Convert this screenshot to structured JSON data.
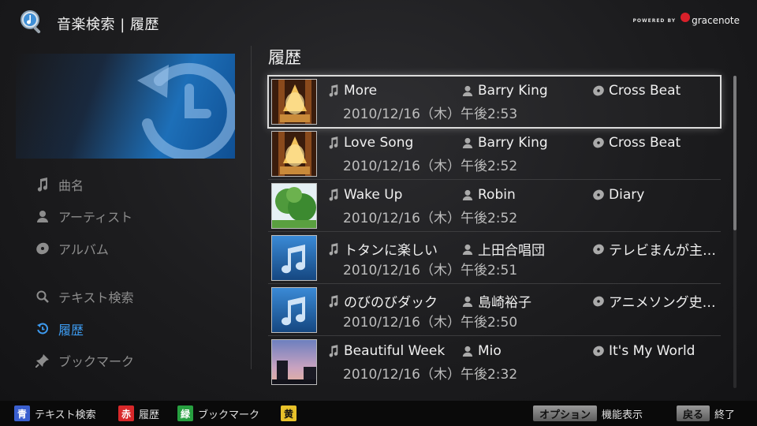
{
  "header": {
    "title": "音楽検索 | 履歴",
    "logo_powered": "POWERED BY",
    "logo_brand": "gracenote"
  },
  "sidebar": {
    "items": [
      {
        "label": "曲名",
        "icon": "music-note-icon",
        "active": false
      },
      {
        "label": "アーティスト",
        "icon": "person-icon",
        "active": false
      },
      {
        "label": "アルバム",
        "icon": "disc-icon",
        "active": false
      },
      {
        "label": "テキスト検索",
        "icon": "search-icon",
        "active": false
      },
      {
        "label": "履歴",
        "icon": "history-icon",
        "active": true
      },
      {
        "label": "ブックマーク",
        "icon": "bookmark-pin-icon",
        "active": false
      }
    ]
  },
  "main": {
    "section_title": "履歴",
    "rows": [
      {
        "song": "More",
        "artist": "Barry King",
        "album": "Cross Beat",
        "datetime": "2010/12/16（木）午後2:53",
        "thumb": "chandelier",
        "selected": true
      },
      {
        "song": "Love Song",
        "artist": "Barry King",
        "album": "Cross Beat",
        "datetime": "2010/12/16（木）午後2:52",
        "thumb": "chandelier",
        "selected": false
      },
      {
        "song": "Wake Up",
        "artist": "Robin",
        "album": "Diary",
        "datetime": "2010/12/16（木）午後2:52",
        "thumb": "tree",
        "selected": false
      },
      {
        "song": "トタンに楽しい",
        "artist": "上田合唱団",
        "album": "テレビまんが主…",
        "datetime": "2010/12/16（木）午後2:51",
        "thumb": "note",
        "selected": false
      },
      {
        "song": "のびのびダック",
        "artist": "島崎裕子",
        "album": "アニメソング史…",
        "datetime": "2010/12/16（木）午後2:50",
        "thumb": "note",
        "selected": false
      },
      {
        "song": "Beautiful Week",
        "artist": "Mio",
        "album": "It's My World",
        "datetime": "2010/12/16（木）午後2:32",
        "thumb": "dusk",
        "selected": false
      }
    ]
  },
  "footer": {
    "blue": {
      "key": "青",
      "label": "テキスト検索",
      "color": "#3a5fcf"
    },
    "red": {
      "key": "赤",
      "label": "履歴",
      "color": "#d8282a"
    },
    "green": {
      "key": "緑",
      "label": "ブックマーク",
      "color": "#27a040"
    },
    "yellow": {
      "key": "黄",
      "label": "",
      "color": "#e8c22a"
    },
    "option": {
      "key": "オプション",
      "label": "機能表示"
    },
    "back": {
      "key": "戻る",
      "label": "終了"
    }
  },
  "colors": {
    "accent": "#3d9bf0",
    "background": "#1c1c1e"
  }
}
